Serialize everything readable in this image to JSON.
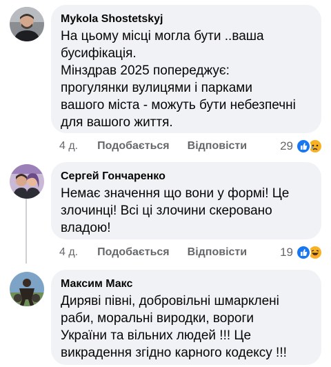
{
  "comments": [
    {
      "author": "Mykola Shostetskyj",
      "text": "На цьому місці могла бути ..ваша\nбусифікація.\nМінздрав 2025 попереджує:\nпрогулянки вулицями і парками\nвашого міста - можуть бути небезпечні\nдля вашого життя.",
      "time": "4 д.",
      "like_label": "Подобається",
      "reply_label": "Відповісти",
      "reaction_count": "29",
      "reactions": [
        "like-icon",
        "sad-icon"
      ]
    },
    {
      "author": "Сергей Гончаренко",
      "text": "Немає значення що вони у формі! Це\nзлочинці! Всі ці злочини скеровано\nвладою!",
      "time": "4 д.",
      "like_label": "Подобається",
      "reply_label": "Відповісти",
      "reaction_count": "19",
      "reactions": [
        "like-icon",
        "haha-icon"
      ]
    },
    {
      "author": "Максим Макс",
      "text": "Диряві півні, добровільні шмарклені\nраби, моральні виродки, вороги\nУкраїни та вільних людей !!! Це\nвикрадення згідно карного кодексу !!!"
    }
  ]
}
